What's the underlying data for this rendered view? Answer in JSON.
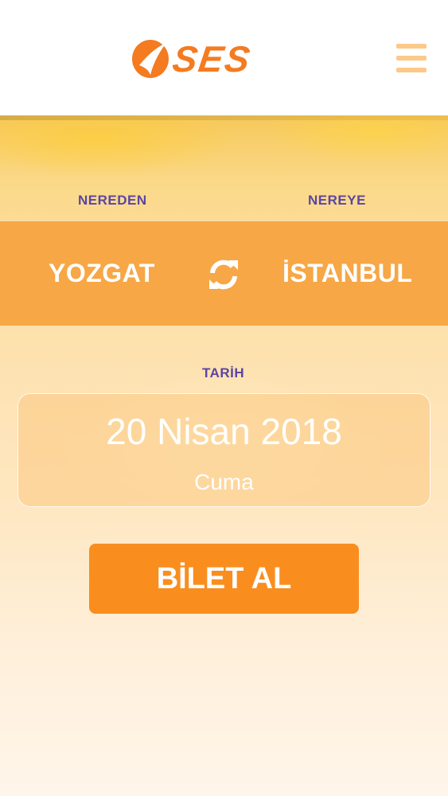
{
  "header": {
    "logo_text": "SES",
    "menu_icon": "hamburger-menu-icon"
  },
  "route": {
    "from_label": "NEREDEN",
    "to_label": "NEREYE",
    "from_city": "YOZGAT",
    "to_city": "İSTANBUL",
    "swap_icon": "swap-refresh-icon"
  },
  "date": {
    "label": "TARİH",
    "value": "20 Nisan 2018",
    "weekday": "Cuma"
  },
  "actions": {
    "buy_label": "BİLET AL"
  },
  "colors": {
    "brand_orange": "#f98e1f",
    "route_bar": "#f7a745",
    "label_purple": "#5b45a3",
    "menu_icon": "#fcc989"
  }
}
